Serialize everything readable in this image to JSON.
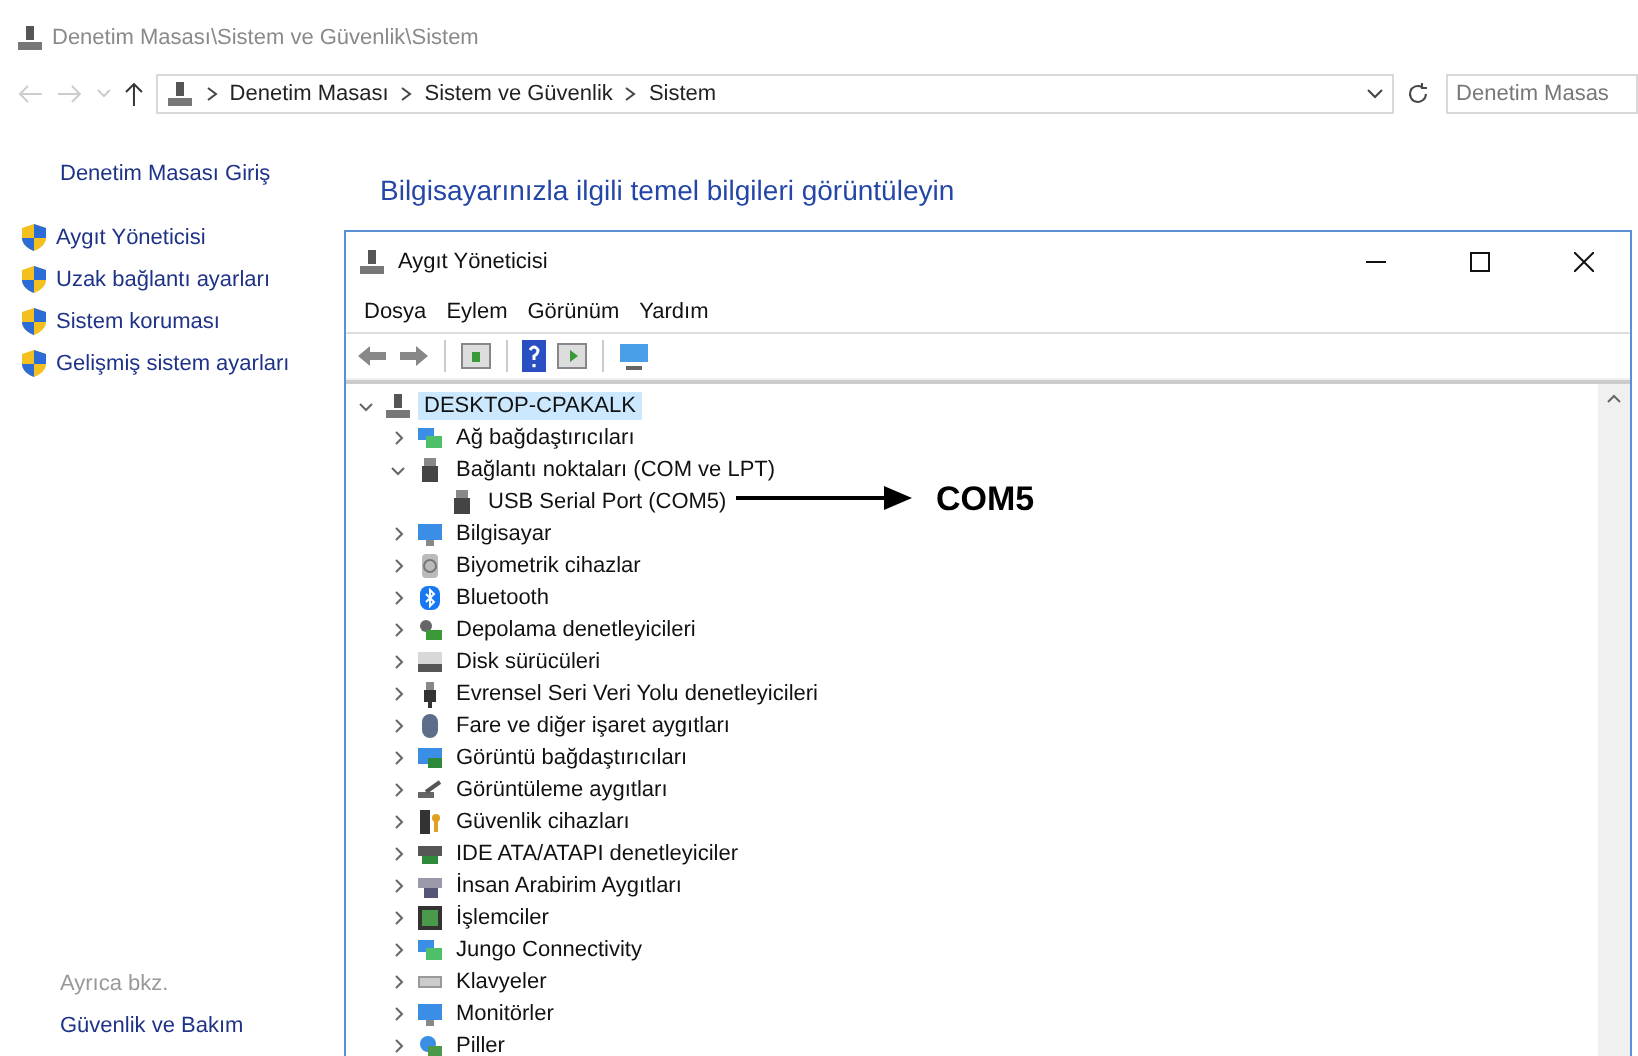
{
  "explorer": {
    "title": "Denetim Masası\\Sistem ve Güvenlik\\Sistem",
    "breadcrumb": [
      "Denetim Masası",
      "Sistem ve Güvenlik",
      "Sistem"
    ],
    "search": {
      "placeholder": "Denetim Masas"
    },
    "sidebar": {
      "home": "Denetim Masası Giriş",
      "links": [
        "Aygıt Yöneticisi",
        "Uzak bağlantı ayarları",
        "Sistem koruması",
        "Gelişmiş sistem ayarları"
      ],
      "see_also_heading": "Ayrıca bkz.",
      "see_also": [
        "Güvenlik ve Bakım"
      ]
    },
    "heading": "Bilgisayarınızla ilgili temel bilgileri görüntüleyin"
  },
  "device_manager": {
    "title": "Aygıt Yöneticisi",
    "menu": [
      "Dosya",
      "Eylem",
      "Görünüm",
      "Yardım"
    ],
    "tree": {
      "label": "DESKTOP-CPAKALK",
      "expanded": true,
      "selected": true,
      "children": [
        {
          "label": "Ağ bağdaştırıcıları",
          "expanded": false,
          "selected": false
        },
        {
          "label": "Bağlantı noktaları (COM ve LPT)",
          "expanded": true,
          "selected": false,
          "children": [
            {
              "label": "USB Serial Port (COM5)",
              "selected": false
            }
          ]
        },
        {
          "label": "Bilgisayar",
          "expanded": false,
          "selected": false
        },
        {
          "label": "Biyometrik cihazlar",
          "expanded": false,
          "selected": false
        },
        {
          "label": "Bluetooth",
          "expanded": false,
          "selected": false
        },
        {
          "label": "Depolama denetleyicileri",
          "expanded": false,
          "selected": false
        },
        {
          "label": "Disk sürücüleri",
          "expanded": false,
          "selected": false
        },
        {
          "label": "Evrensel Seri Veri Yolu denetleyicileri",
          "expanded": false,
          "selected": false
        },
        {
          "label": "Fare ve diğer işaret aygıtları",
          "expanded": false,
          "selected": false
        },
        {
          "label": "Görüntü bağdaştırıcıları",
          "expanded": false,
          "selected": false
        },
        {
          "label": "Görüntüleme aygıtları",
          "expanded": false,
          "selected": false
        },
        {
          "label": "Güvenlik cihazları",
          "expanded": false,
          "selected": false
        },
        {
          "label": "IDE ATA/ATAPI denetleyiciler",
          "expanded": false,
          "selected": false
        },
        {
          "label": "İnsan Arabirim Aygıtları",
          "expanded": false,
          "selected": false
        },
        {
          "label": "İşlemciler",
          "expanded": false,
          "selected": false
        },
        {
          "label": "Jungo Connectivity",
          "expanded": false,
          "selected": false
        },
        {
          "label": "Klavyeler",
          "expanded": false,
          "selected": false
        },
        {
          "label": "Monitörler",
          "expanded": false,
          "selected": false
        },
        {
          "label": "Piller",
          "expanded": false,
          "selected": false
        }
      ]
    },
    "annotation": {
      "label": "COM5"
    }
  }
}
